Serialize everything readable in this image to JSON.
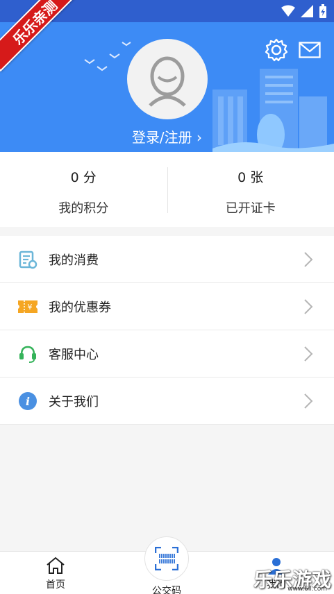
{
  "ribbon": {
    "text": "乐乐亲测"
  },
  "header": {
    "login_label": "登录/注册",
    "chevron": "›"
  },
  "stats": [
    {
      "value": "0 分",
      "label": "我的积分"
    },
    {
      "value": "0 张",
      "label": "已开证卡"
    }
  ],
  "menu": [
    {
      "label": "我的消费",
      "icon": "receipt-icon"
    },
    {
      "label": "我的优惠券",
      "icon": "coupon-icon"
    },
    {
      "label": "客服中心",
      "icon": "headset-icon"
    },
    {
      "label": "关于我们",
      "icon": "info-icon"
    }
  ],
  "bottom_nav": [
    {
      "label": "首页",
      "icon": "home-icon"
    },
    {
      "label": "公交码",
      "icon": "qrcode-scan-icon"
    },
    {
      "label": "我的",
      "icon": "profile-icon"
    }
  ],
  "watermark": {
    "text": "乐乐游戏",
    "sub": "www.6ll.com"
  },
  "colors": {
    "header": "#3d8bf5",
    "statusbar": "#2f5fce",
    "ribbon": "#d61a1a"
  }
}
